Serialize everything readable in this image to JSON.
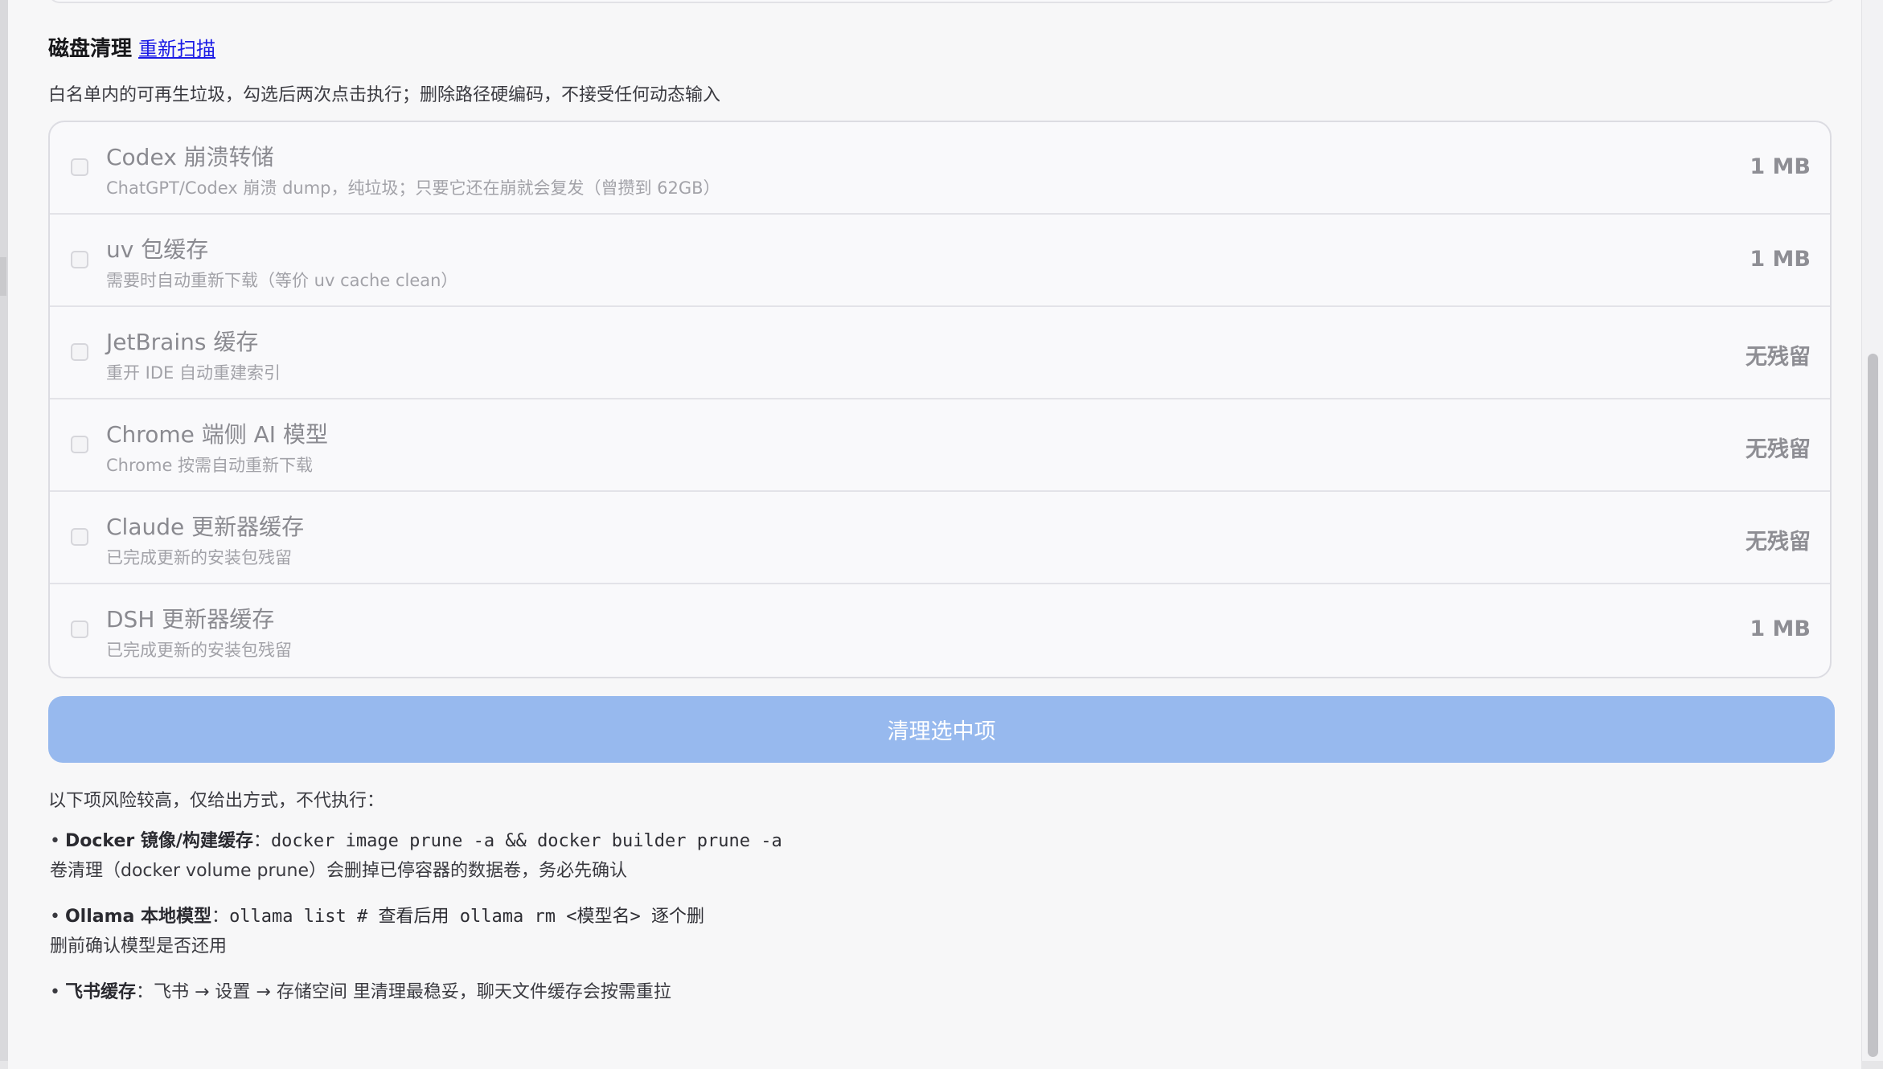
{
  "section": {
    "title": "磁盘清理",
    "rescan_label": "重新扫描",
    "description": "白名单内的可再生垃圾，勾选后两次点击执行；删除路径硬编码，不接受任何动态输入"
  },
  "items": [
    {
      "title": "Codex 崩溃转储",
      "desc": "ChatGPT/Codex 崩溃 dump，纯垃圾；只要它还在崩就会复发（曾攒到 62GB）",
      "size": "1 MB",
      "checked": false
    },
    {
      "title": "uv 包缓存",
      "desc": "需要时自动重新下载（等价 uv cache clean）",
      "size": "1 MB",
      "checked": false
    },
    {
      "title": "JetBrains 缓存",
      "desc": "重开 IDE 自动重建索引",
      "size": "无残留",
      "checked": false
    },
    {
      "title": "Chrome 端侧 AI 模型",
      "desc": "Chrome 按需自动重新下载",
      "size": "无残留",
      "checked": false
    },
    {
      "title": "Claude 更新器缓存",
      "desc": "已完成更新的安装包残留",
      "size": "无残留",
      "checked": false
    },
    {
      "title": "DSH 更新器缓存",
      "desc": "已完成更新的安装包残留",
      "size": "1 MB",
      "checked": false
    }
  ],
  "clean_button_label": "清理选中项",
  "risk": {
    "intro": "以下项风险较高，仅给出方式，不代执行：",
    "bullet": "•",
    "items": [
      {
        "name": "Docker 镜像/构建缓存",
        "sep": "：",
        "command": "docker image prune -a && docker builder prune -a",
        "note": "卷清理（docker volume prune）会删掉已停容器的数据卷，务必先确认"
      },
      {
        "name": "Ollama 本地模型",
        "sep": "：",
        "command_a": "ollama list",
        "command_b": " # 查看后用 ",
        "command_c": "ollama rm <模型名>",
        "command_d": " 逐个删",
        "note": "删前确认模型是否还用"
      },
      {
        "name": "飞书缓存",
        "sep": "：",
        "text": "飞书 → 设置 → 存储空间 里清理最稳妥，聊天文件缓存会按需重拉"
      }
    ]
  },
  "colors": {
    "accent_button": "#97b9ee",
    "link": "#1a1ae6"
  }
}
